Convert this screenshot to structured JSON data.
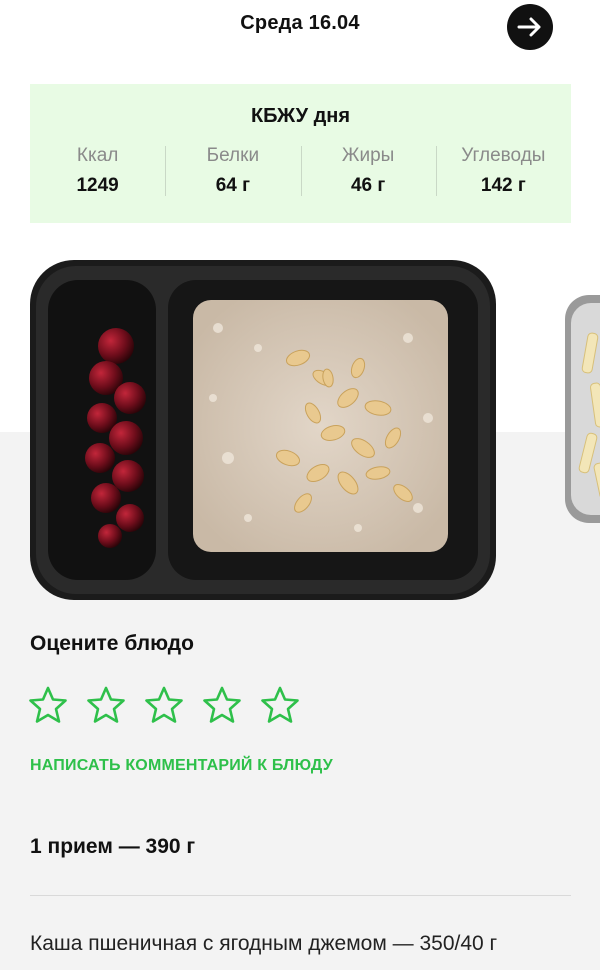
{
  "header": {
    "title": "Среда 16.04",
    "next_icon": "arrow-right-icon"
  },
  "nutrition": {
    "title": "КБЖУ дня",
    "items": [
      {
        "label": "Ккал",
        "value": "1249"
      },
      {
        "label": "Белки",
        "value": "64 г"
      },
      {
        "label": "Жиры",
        "value": "46 г"
      },
      {
        "label": "Углеводы",
        "value": "142 г"
      }
    ]
  },
  "rating": {
    "title": "Оцените блюдо",
    "stars": 5,
    "selected": 0,
    "star_color": "#2ec04a"
  },
  "comment_link": "НАПИСАТЬ КОММЕНТАРИЙ К БЛЮДУ",
  "meal": {
    "title": "1 прием — 390 г",
    "dish": "Каша пшеничная с ягодным джемом — 350/40 г"
  },
  "colors": {
    "accent": "#2ec04a",
    "nutrition_bg": "#e8fbe4"
  }
}
